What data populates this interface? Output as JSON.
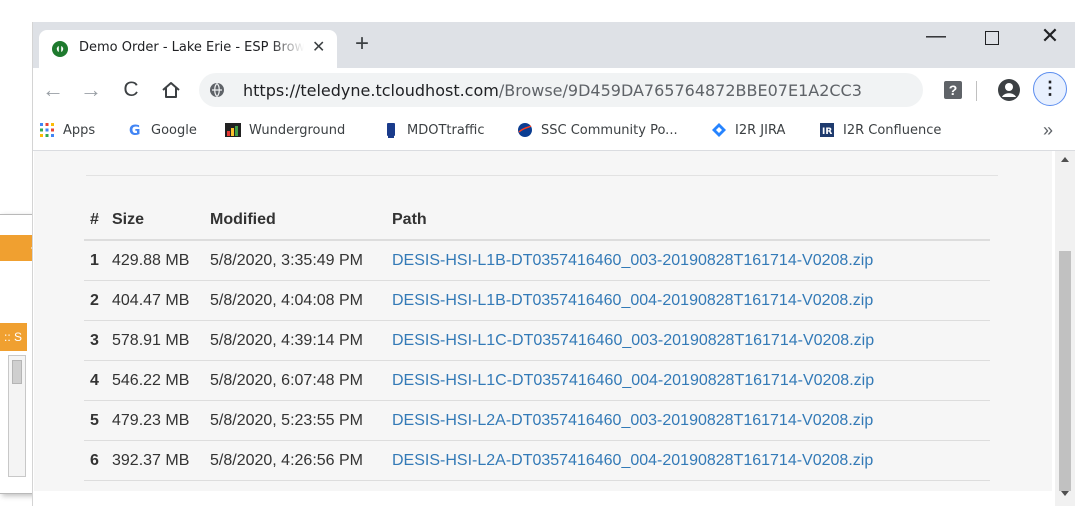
{
  "browser": {
    "tab_title": "Demo Order - Lake Erie - ESP Browse",
    "tab_close": "✕",
    "new_tab": "+",
    "window_controls": {
      "minimize": "—",
      "close": "✕"
    },
    "nav": {
      "back": "←",
      "forward": "→",
      "reload": "C",
      "home_icon": "home-icon"
    },
    "url_domain": "https://teledyne.tcloudhost.com",
    "url_path": "/Browse/9D459DA765764872BBE07E1A2CC3",
    "help_label": "?",
    "menu_label": "⋮"
  },
  "bookmarks": {
    "items": [
      {
        "label": "Apps",
        "icon": "apps-grid-icon"
      },
      {
        "label": "Google",
        "icon": "google-icon"
      },
      {
        "label": "Wunderground",
        "icon": "wunderground-icon"
      },
      {
        "label": "MDOTtraffic",
        "icon": "mdot-icon"
      },
      {
        "label": "SSC Community Po...",
        "icon": "nasa-icon"
      },
      {
        "label": "I2R JIRA",
        "icon": "jira-icon"
      },
      {
        "label": "I2R Confluence",
        "icon": "confluence-icon"
      }
    ],
    "more": "»"
  },
  "table": {
    "headers": [
      "#",
      "Size",
      "Modified",
      "Path"
    ],
    "rows": [
      {
        "num": "1",
        "size": "429.88 MB",
        "modified": "5/8/2020, 3:35:49 PM",
        "path": "DESIS-HSI-L1B-DT0357416460_003-20190828T161714-V0208.zip"
      },
      {
        "num": "2",
        "size": "404.47 MB",
        "modified": "5/8/2020, 4:04:08 PM",
        "path": "DESIS-HSI-L1B-DT0357416460_004-20190828T161714-V0208.zip"
      },
      {
        "num": "3",
        "size": "578.91 MB",
        "modified": "5/8/2020, 4:39:14 PM",
        "path": "DESIS-HSI-L1C-DT0357416460_003-20190828T161714-V0208.zip"
      },
      {
        "num": "4",
        "size": "546.22 MB",
        "modified": "5/8/2020, 6:07:48 PM",
        "path": "DESIS-HSI-L1C-DT0357416460_004-20190828T161714-V0208.zip"
      },
      {
        "num": "5",
        "size": "479.23 MB",
        "modified": "5/8/2020, 5:23:55 PM",
        "path": "DESIS-HSI-L2A-DT0357416460_003-20190828T161714-V0208.zip"
      },
      {
        "num": "6",
        "size": "392.37 MB",
        "modified": "5/8/2020, 4:26:56 PM",
        "path": "DESIS-HSI-L2A-DT0357416460_004-20190828T161714-V0208.zip"
      }
    ]
  },
  "background_window": {
    "toolbar_glyph": ":: S"
  },
  "colors": {
    "link": "#337ab7",
    "accent_orange": "#f0a030",
    "tabstrip": "#dee1e6"
  }
}
